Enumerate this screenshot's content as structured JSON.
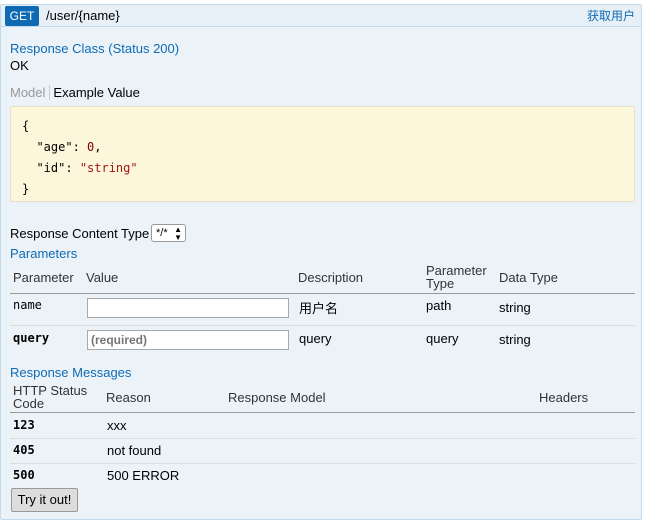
{
  "operation": {
    "method": "GET",
    "path": "/user/{name}",
    "summary": "获取用户"
  },
  "response_class": {
    "heading": "Response Class (Status 200)",
    "text": "OK"
  },
  "model_tabs": {
    "model": "Model",
    "example": "Example Value"
  },
  "example_json": {
    "open": "{",
    "line1_key": "\"age\"",
    "line1_val": "0",
    "line2_key": "\"id\"",
    "line2_val": "\"string\"",
    "close": "}"
  },
  "content_type": {
    "label": "Response Content Type",
    "selected": "*/*"
  },
  "parameters": {
    "heading": "Parameters",
    "columns": {
      "parameter": "Parameter",
      "value": "Value",
      "description": "Description",
      "parameter_type": "Parameter Type",
      "data_type": "Data Type"
    },
    "rows": [
      {
        "name": "name",
        "value": "",
        "placeholder": "",
        "description": "用户名",
        "param_type": "path",
        "data_type": "string"
      },
      {
        "name": "query",
        "value": "",
        "placeholder": "(required)",
        "description": "query",
        "param_type": "query",
        "data_type": "string"
      }
    ]
  },
  "response_messages": {
    "heading": "Response Messages",
    "columns": {
      "code": "HTTP Status Code",
      "reason": "Reason",
      "model": "Response Model",
      "headers": "Headers"
    },
    "rows": [
      {
        "code": "123",
        "reason": "xxx"
      },
      {
        "code": "405",
        "reason": "not found"
      },
      {
        "code": "500",
        "reason": "500 ERROR"
      }
    ]
  },
  "try_button": "Try it out!",
  "colors": {
    "accent": "#0f6ab4",
    "panel_bg": "#ebf3f9",
    "json_bg": "#fcf6db"
  }
}
